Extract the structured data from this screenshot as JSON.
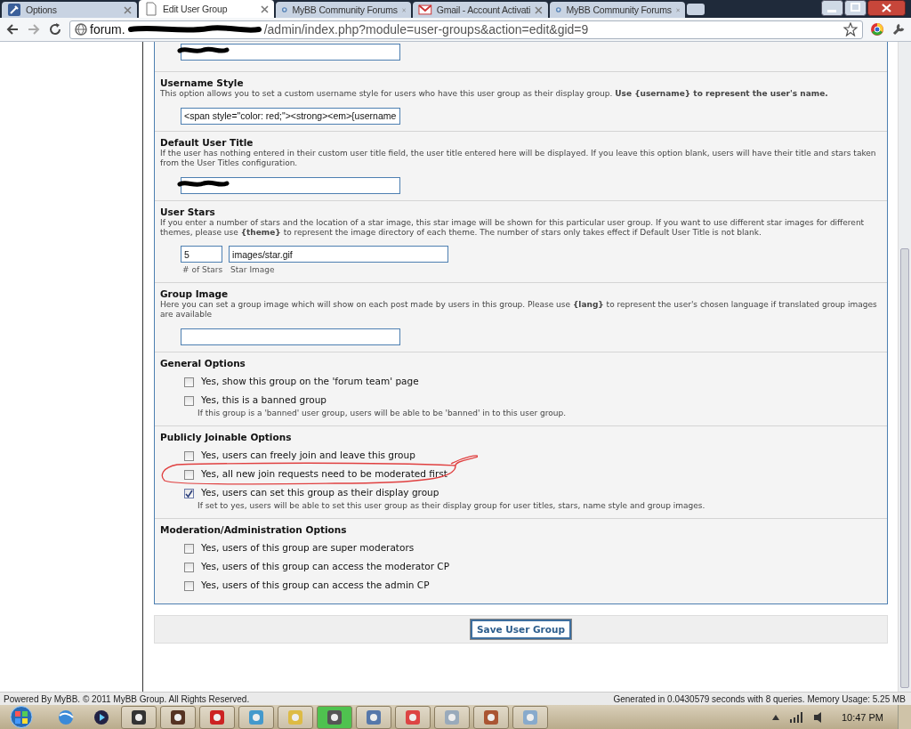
{
  "browser": {
    "tabs": [
      {
        "label": "Options",
        "kind": "wrench",
        "selected": false
      },
      {
        "label": "Edit User Group",
        "kind": "page",
        "selected": true
      },
      {
        "label": "MyBB Community Forums",
        "kind": "mybb",
        "selected": false
      },
      {
        "label": "Gmail - Account Activati",
        "kind": "mail",
        "selected": false
      },
      {
        "label": "MyBB Community Forums",
        "kind": "mybb",
        "selected": false
      }
    ],
    "address": {
      "host": "forum.",
      "path": "/admin/index.php?module=user-groups&action=edit&gid=9",
      "redacted": true
    }
  },
  "sections": [
    {
      "kind": "text",
      "redacted": true
    },
    {
      "kind": "text",
      "title": "Username Style",
      "description": "This option allows you to set a custom username style for users who have this user group as their display group. **Use {username} to represent the user's name.**",
      "value": "<span style=\"color: red;\"><strong><em>{username",
      "redacted": false
    },
    {
      "kind": "text",
      "title": "Default User Title",
      "description": "If the user has nothing entered in their custom user title field, the user title entered here will be displayed. If you leave this option blank, users will have their title and stars taken from the User Titles configuration.",
      "redacted": true
    },
    {
      "kind": "stars",
      "title": "User Stars",
      "description": "If you enter a number of stars and the location of a star image, this star image will be shown for this particular user group. If you want to use different star images for different themes, please use **{theme}** to represent the image directory of each theme. The number of stars only takes effect if Default User Title is not blank.",
      "count": "5",
      "count_caption": "# of Stars",
      "image": "images/star.gif",
      "image_caption": "Star Image"
    },
    {
      "kind": "text",
      "title": "Group Image",
      "description": "Here you can set a group image which will show on each post made by users in this group. Please use **{lang}** to represent the user's chosen language if translated group images are available",
      "redacted": false
    },
    {
      "kind": "checks",
      "title": "General Options",
      "options": [
        {
          "label": "Yes, show this group on the 'forum team' page",
          "checked": false
        },
        {
          "label": "Yes, this is a banned group",
          "checked": false,
          "note": "If this group is a 'banned' user group, users will be able to be 'banned' in to this user group."
        }
      ]
    },
    {
      "kind": "checks",
      "title": "Publicly Joinable Options",
      "annotated": true,
      "options": [
        {
          "label": "Yes, users can freely join and leave this group",
          "checked": false
        },
        {
          "label": "Yes, all new join requests need to be moderated first",
          "checked": false
        },
        {
          "label": "Yes, users can set this group as their display group",
          "checked": true,
          "note": "If set to yes, users will be able to set this user group as their display group for user titles, stars, name style and group images."
        }
      ]
    },
    {
      "kind": "checks",
      "title": "Moderation/Administration Options",
      "options": [
        {
          "label": "Yes, users of this group are super moderators",
          "checked": false
        },
        {
          "label": "Yes, users of this group can access the moderator CP",
          "checked": false
        },
        {
          "label": "Yes, users of this group can access the admin CP",
          "checked": false
        }
      ]
    }
  ],
  "save_button": "Save User Group",
  "footer": {
    "left": "Powered By MyBB. © 2011 MyBB Group. All Rights Reserved.",
    "right": "Generated in 0.0430579 seconds with 8 queries. Memory Usage: 5.25 MB"
  },
  "taskbar": {
    "apps": [
      {
        "selected": false
      },
      {
        "selected": false
      },
      {
        "selected": false
      },
      {
        "selected": false
      },
      {
        "selected": false
      },
      {
        "selected": true
      },
      {
        "selected": false
      },
      {
        "selected": false
      },
      {
        "selected": false
      },
      {
        "selected": false
      },
      {
        "selected": false
      }
    ],
    "clock": "10:47 PM"
  }
}
